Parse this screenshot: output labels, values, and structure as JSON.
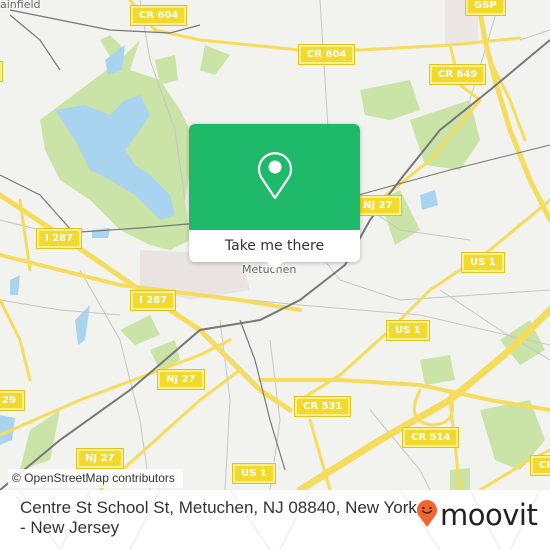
{
  "map": {
    "colors": {
      "background": "#f2f2ef",
      "park": "#c9e4a6",
      "water": "#a8d4f0",
      "highway": "#f6dc5c",
      "railway": "#777777",
      "minor_road": "#c8c6c0",
      "urban": "#e9e4e2"
    },
    "place_labels": [
      {
        "name": "Plainfield",
        "text": "ainfield"
      },
      {
        "name": "Metuchen",
        "text": "Metuchen"
      }
    ],
    "road_shields": [
      {
        "name": "cr-604-west",
        "text": "CR 604"
      },
      {
        "name": "cr-604-east",
        "text": "CR 604"
      },
      {
        "name": "gsp",
        "text": "GSP"
      },
      {
        "name": "cr-649",
        "text": "CR 649"
      },
      {
        "name": "nj-27-north",
        "text": "NJ 27"
      },
      {
        "name": "i-287-west",
        "text": "I 287"
      },
      {
        "name": "i-287-south",
        "text": "I 287"
      },
      {
        "name": "us-1-north",
        "text": "US 1"
      },
      {
        "name": "us-1-mid",
        "text": "US 1"
      },
      {
        "name": "nj-27-mid",
        "text": "NJ 27"
      },
      {
        "name": "cr-531",
        "text": "CR 531"
      },
      {
        "name": "cr-514",
        "text": "CR 514"
      },
      {
        "name": "nj-27-south",
        "text": "NJ 27"
      },
      {
        "name": "us-1-south",
        "text": "US 1"
      },
      {
        "name": "cr-529-partial",
        "text": "29"
      },
      {
        "name": "cr-partial-east",
        "text": "CR"
      },
      {
        "name": "partial-west",
        "text": ""
      }
    ],
    "attribution": "© OpenStreetMap contributors"
  },
  "popup": {
    "icon": "map-pin-icon",
    "button_label": "Take me there",
    "color": "#1fb96a"
  },
  "footer": {
    "address": "Centre St School St, Metuchen, NJ 08840, New York - New Jersey",
    "logo_text": "moovit",
    "logo_icon": "moovit-pin-smile-icon",
    "logo_color": "#f26430"
  }
}
